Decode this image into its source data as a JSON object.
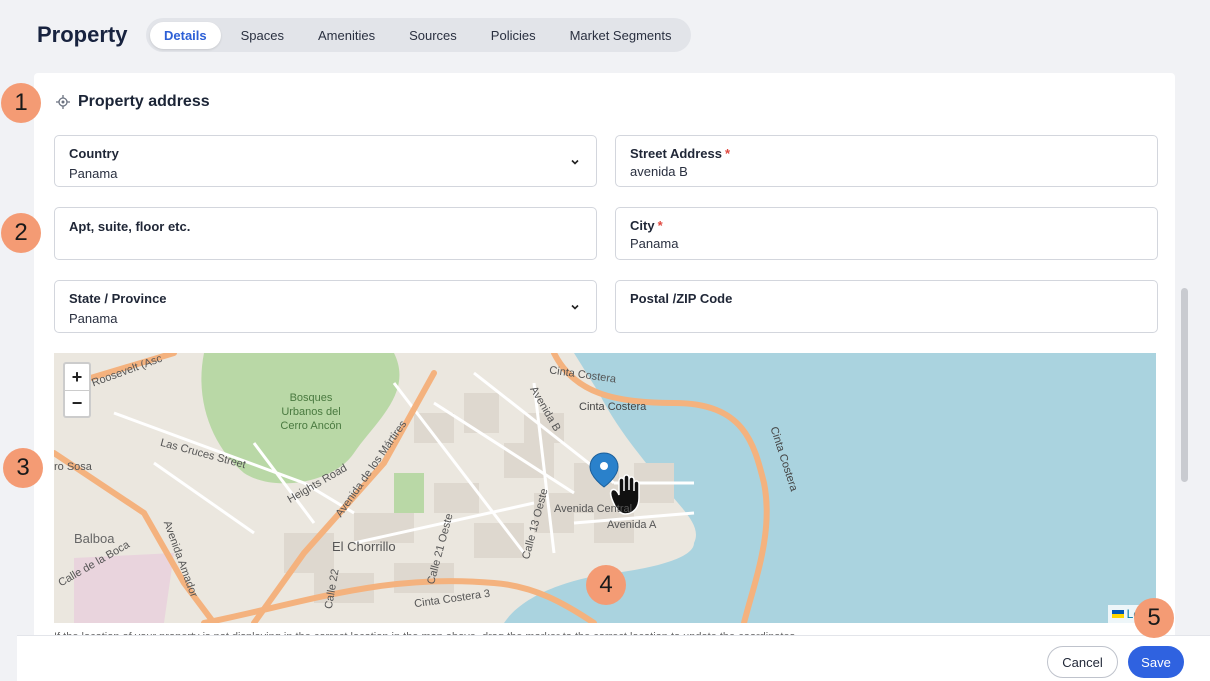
{
  "header": {
    "title": "Property"
  },
  "tabs": [
    {
      "label": "Details"
    },
    {
      "label": "Spaces"
    },
    {
      "label": "Amenities"
    },
    {
      "label": "Sources"
    },
    {
      "label": "Policies"
    },
    {
      "label": "Market Segments"
    }
  ],
  "section": {
    "title": "Property address"
  },
  "fields": {
    "country": {
      "label": "Country",
      "value": "Panama"
    },
    "street": {
      "label": "Street Address",
      "required": "*",
      "value": "avenida B"
    },
    "apt": {
      "label": "Apt, suite, floor etc.",
      "value": ""
    },
    "city": {
      "label": "City",
      "required": "*",
      "value": "Panama"
    },
    "state": {
      "label": "State / Province",
      "value": "Panama"
    },
    "postal": {
      "label": "Postal /ZIP Code",
      "value": ""
    }
  },
  "map": {
    "zoom_in": "+",
    "zoom_out": "−",
    "attribution": "Leaf",
    "labels": [
      "Cinta Costera",
      "Cinta Costera",
      "Cinta Costera",
      "Balboa",
      "El Chorrillo",
      "Bosques Urbanos del Cerro Ancón",
      "Avenida de los Mártires",
      "Avenida Amador",
      "Heights Road",
      "Las Cruces Street",
      "Avenida B",
      "Avenida A",
      "Avenida Central",
      "Calle 13 Oeste",
      "Calle 21 Oeste",
      "ro Sosa",
      "Roosevelt (Asc",
      "Cinta Costera 3",
      "Calle de la Boca",
      "Calle 22"
    ]
  },
  "hint": "If the location of your property is not displaying in the correct location in the map above, drag the marker to the correct location to update the coordinates.",
  "footer": {
    "cancel": "Cancel",
    "save": "Save"
  },
  "markers": [
    "1",
    "2",
    "3",
    "4",
    "5"
  ],
  "colors": {
    "accent": "#2f62e0",
    "marker": "#f49b74",
    "water": "#aad3df",
    "park": "#b5d7a4"
  }
}
